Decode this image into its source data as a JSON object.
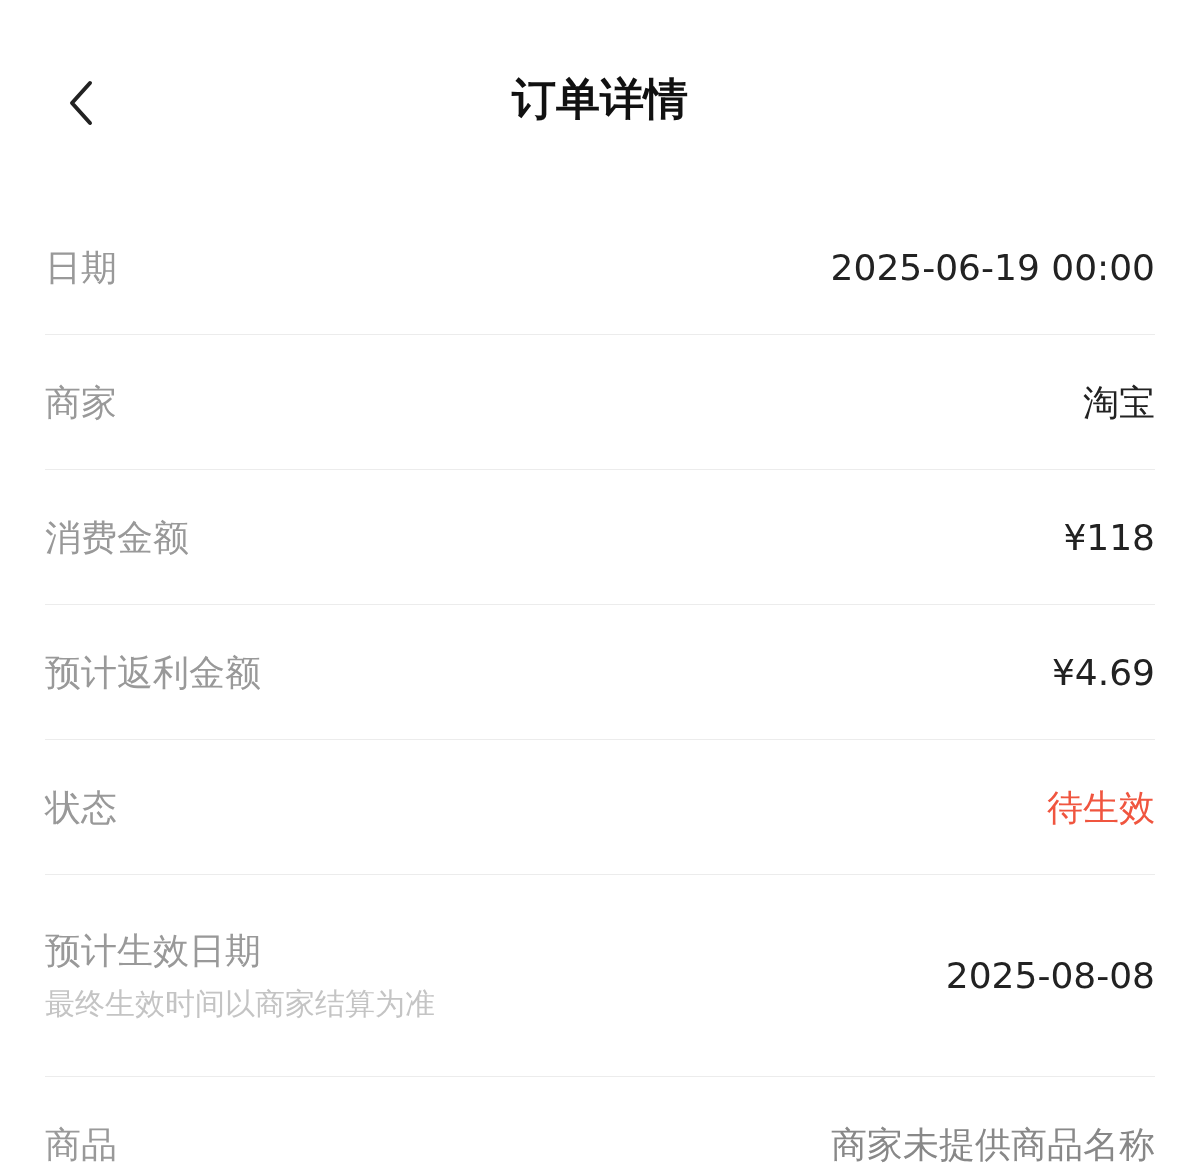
{
  "header": {
    "title": "订单详情"
  },
  "rows": [
    {
      "label": "日期",
      "value": "2025-06-19 00:00",
      "kind": "normal"
    },
    {
      "label": "商家",
      "value": "淘宝",
      "kind": "normal"
    },
    {
      "label": "消费金额",
      "value": "¥118",
      "kind": "normal"
    },
    {
      "label": "预计返利金额",
      "value": "¥4.69",
      "kind": "normal"
    },
    {
      "label": "状态",
      "value": "待生效",
      "kind": "alert"
    },
    {
      "label": "预计生效日期",
      "note": "最终生效时间以商家结算为准",
      "value": "2025-08-08",
      "kind": "normal"
    },
    {
      "label": "商品",
      "value": "商家未提供商品名称",
      "kind": "muted"
    }
  ]
}
